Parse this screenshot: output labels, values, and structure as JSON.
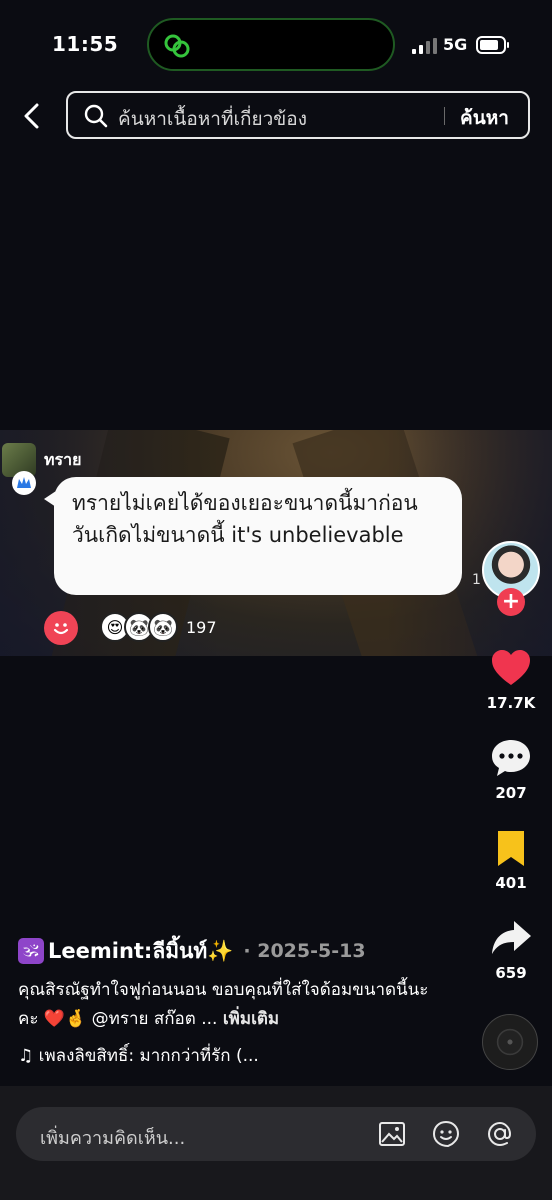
{
  "status_bar": {
    "time": "11:55",
    "network": "5G"
  },
  "search": {
    "placeholder": "ค้นหาเนื้อหาที่เกี่ยวข้อง",
    "submit_label": "ค้นหา"
  },
  "overlay_comment": {
    "author": "ทราย",
    "text": "ทรายไม่เคยได้ของเยอะขนาดนี้มาก่อน วันเกิดไม่ขนาดนี้ it's unbelievable",
    "reaction_count": "197",
    "clipped_text": "1"
  },
  "actions": {
    "likes": "17.7K",
    "comments": "207",
    "saves": "401",
    "shares": "659"
  },
  "post": {
    "author_emoji": "🕉",
    "author": "Leemint:ลีมิ้นท์✨",
    "date": "· 2025-5-13",
    "caption": "คุณสิรณัฐทำใจฟูก่อนนอน ขอบคุณที่ใส่ใจด้อมขนาดนี้นะคะ ❤️🤞 @ทราย สก๊อต ...",
    "more_label": "เพิ่มเติม",
    "music": "♫ เพลงลิขสิทธิ์: มากกว่าที่รัก (..."
  },
  "comment_bar": {
    "placeholder": "เพิ่มความคิดเห็น..."
  },
  "colors": {
    "like_red": "#f0354f",
    "save_yellow": "#f7c21b",
    "follow_red": "#f03d52",
    "island_green": "#35c43c"
  },
  "icons": [
    "back-arrow-icon",
    "search-icon",
    "heart-icon",
    "comment-icon",
    "bookmark-icon",
    "share-icon",
    "image-icon",
    "sticker-icon",
    "mention-icon"
  ]
}
